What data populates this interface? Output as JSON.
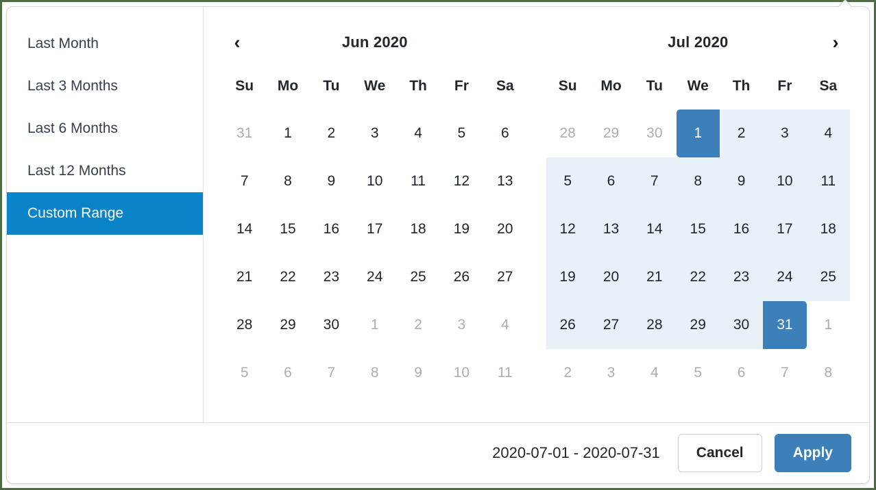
{
  "picker": {
    "caret_icon": "caret-up-icon"
  },
  "sidebar": {
    "items": [
      {
        "label": "Last Month",
        "selected": false
      },
      {
        "label": "Last 3 Months",
        "selected": false
      },
      {
        "label": "Last 6 Months",
        "selected": false
      },
      {
        "label": "Last 12 Months",
        "selected": false
      },
      {
        "label": "Custom Range",
        "selected": true
      }
    ]
  },
  "calendars": [
    {
      "title": "Jun 2020",
      "nav": {
        "prev_icon": "chevron-left-icon",
        "prev_label": "‹",
        "show_prev": true,
        "show_next": false
      },
      "weekdays": [
        "Su",
        "Mo",
        "Tu",
        "We",
        "Th",
        "Fr",
        "Sa"
      ],
      "weeks": [
        [
          {
            "day": "31",
            "state": "off"
          },
          {
            "day": "1",
            "state": "normal"
          },
          {
            "day": "2",
            "state": "normal"
          },
          {
            "day": "3",
            "state": "normal"
          },
          {
            "day": "4",
            "state": "normal"
          },
          {
            "day": "5",
            "state": "normal"
          },
          {
            "day": "6",
            "state": "normal"
          }
        ],
        [
          {
            "day": "7",
            "state": "normal"
          },
          {
            "day": "8",
            "state": "normal"
          },
          {
            "day": "9",
            "state": "normal"
          },
          {
            "day": "10",
            "state": "normal"
          },
          {
            "day": "11",
            "state": "normal"
          },
          {
            "day": "12",
            "state": "normal"
          },
          {
            "day": "13",
            "state": "normal"
          }
        ],
        [
          {
            "day": "14",
            "state": "normal"
          },
          {
            "day": "15",
            "state": "normal"
          },
          {
            "day": "16",
            "state": "normal"
          },
          {
            "day": "17",
            "state": "normal"
          },
          {
            "day": "18",
            "state": "normal"
          },
          {
            "day": "19",
            "state": "normal"
          },
          {
            "day": "20",
            "state": "normal"
          }
        ],
        [
          {
            "day": "21",
            "state": "normal"
          },
          {
            "day": "22",
            "state": "normal"
          },
          {
            "day": "23",
            "state": "normal"
          },
          {
            "day": "24",
            "state": "normal"
          },
          {
            "day": "25",
            "state": "normal"
          },
          {
            "day": "26",
            "state": "normal"
          },
          {
            "day": "27",
            "state": "normal"
          }
        ],
        [
          {
            "day": "28",
            "state": "normal"
          },
          {
            "day": "29",
            "state": "normal"
          },
          {
            "day": "30",
            "state": "normal"
          },
          {
            "day": "1",
            "state": "off"
          },
          {
            "day": "2",
            "state": "off"
          },
          {
            "day": "3",
            "state": "off"
          },
          {
            "day": "4",
            "state": "off"
          }
        ],
        [
          {
            "day": "5",
            "state": "off"
          },
          {
            "day": "6",
            "state": "off"
          },
          {
            "day": "7",
            "state": "off"
          },
          {
            "day": "8",
            "state": "off"
          },
          {
            "day": "9",
            "state": "off"
          },
          {
            "day": "10",
            "state": "off"
          },
          {
            "day": "11",
            "state": "off"
          }
        ]
      ]
    },
    {
      "title": "Jul 2020",
      "nav": {
        "next_icon": "chevron-right-icon",
        "next_label": "›",
        "show_prev": false,
        "show_next": true
      },
      "weekdays": [
        "Su",
        "Mo",
        "Tu",
        "We",
        "Th",
        "Fr",
        "Sa"
      ],
      "weeks": [
        [
          {
            "day": "28",
            "state": "off"
          },
          {
            "day": "29",
            "state": "off"
          },
          {
            "day": "30",
            "state": "off"
          },
          {
            "day": "1",
            "state": "start-date"
          },
          {
            "day": "2",
            "state": "in-range"
          },
          {
            "day": "3",
            "state": "in-range"
          },
          {
            "day": "4",
            "state": "in-range"
          }
        ],
        [
          {
            "day": "5",
            "state": "in-range"
          },
          {
            "day": "6",
            "state": "in-range"
          },
          {
            "day": "7",
            "state": "in-range"
          },
          {
            "day": "8",
            "state": "in-range"
          },
          {
            "day": "9",
            "state": "in-range"
          },
          {
            "day": "10",
            "state": "in-range"
          },
          {
            "day": "11",
            "state": "in-range"
          }
        ],
        [
          {
            "day": "12",
            "state": "in-range"
          },
          {
            "day": "13",
            "state": "in-range"
          },
          {
            "day": "14",
            "state": "in-range"
          },
          {
            "day": "15",
            "state": "in-range"
          },
          {
            "day": "16",
            "state": "in-range"
          },
          {
            "day": "17",
            "state": "in-range"
          },
          {
            "day": "18",
            "state": "in-range"
          }
        ],
        [
          {
            "day": "19",
            "state": "in-range"
          },
          {
            "day": "20",
            "state": "in-range"
          },
          {
            "day": "21",
            "state": "in-range"
          },
          {
            "day": "22",
            "state": "in-range"
          },
          {
            "day": "23",
            "state": "in-range"
          },
          {
            "day": "24",
            "state": "in-range"
          },
          {
            "day": "25",
            "state": "in-range"
          }
        ],
        [
          {
            "day": "26",
            "state": "in-range"
          },
          {
            "day": "27",
            "state": "in-range"
          },
          {
            "day": "28",
            "state": "in-range"
          },
          {
            "day": "29",
            "state": "in-range"
          },
          {
            "day": "30",
            "state": "in-range"
          },
          {
            "day": "31",
            "state": "end-date"
          },
          {
            "day": "1",
            "state": "off"
          }
        ],
        [
          {
            "day": "2",
            "state": "off"
          },
          {
            "day": "3",
            "state": "off"
          },
          {
            "day": "4",
            "state": "off"
          },
          {
            "day": "5",
            "state": "off"
          },
          {
            "day": "6",
            "state": "off"
          },
          {
            "day": "7",
            "state": "off"
          },
          {
            "day": "8",
            "state": "off"
          }
        ]
      ]
    }
  ],
  "footer": {
    "range_label": "2020-07-01 - 2020-07-31",
    "cancel_label": "Cancel",
    "apply_label": "Apply"
  },
  "colors": {
    "frame_green": "#4d6b45",
    "sidebar_selected_blue": "#0b83c9",
    "date_selected_blue": "#3d7fb8",
    "in_range_blue": "#e9f1f8",
    "text_dark": "#22272e",
    "text_muted": "#adadad",
    "border_gray": "#e2e2e2"
  }
}
